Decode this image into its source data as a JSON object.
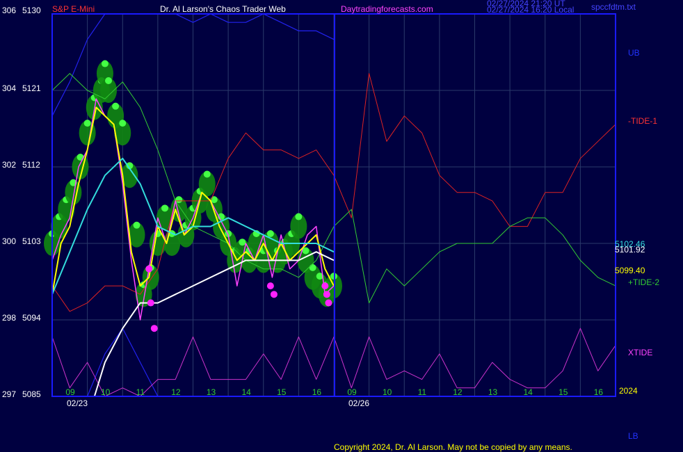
{
  "header": {
    "instrument": "S&P E-Mini",
    "author": "Dr. Al Larson's Chaos Trader Web",
    "site": "Daytradingforecasts.com",
    "time_line1": "02/27/2024 21:20 UT",
    "time_line2": "02/27/2024 16:20 Local",
    "file": "spccfdtm.txt"
  },
  "footer": {
    "copyright": "Copyright 2024, Dr. Al Larson. May not be copied by any means."
  },
  "colors": {
    "background": "#000040",
    "frame": "#1a1aff",
    "grid": "#2a3a6a",
    "price": "#ff44ff",
    "yellow_avg": "#ffff00",
    "cyan_avg": "#33dddd",
    "white_avg": "#ffffff",
    "tide1": "#dd2222",
    "tide2": "#33cc33",
    "xtide": "#cc33cc",
    "bands": "#2222ee",
    "marker_green": "#22cc22",
    "marker_magenta": "#ff22ff"
  },
  "chart_data": {
    "type": "line",
    "title": "S&P E-Mini",
    "y_axis_left_outer": {
      "ticks": [
        "306",
        "304",
        "302",
        "300",
        "298",
        "297"
      ]
    },
    "y_axis_left_inner": {
      "ticks": [
        "5130",
        "5121",
        "5112",
        "5103",
        "5094",
        "5085"
      ],
      "range": [
        5085,
        5130
      ]
    },
    "x_axis": {
      "hour_ticks": [
        "09",
        "10",
        "11",
        "12",
        "13",
        "14",
        "15",
        "16",
        "09",
        "10",
        "11",
        "12",
        "13",
        "14",
        "15",
        "16"
      ],
      "dates": [
        "02/23",
        "02/26"
      ],
      "year": "2024"
    },
    "right_labels": {
      "ub": "UB",
      "tide1": "-TIDE-1",
      "v1": "5102.46",
      "v2": "5101.92",
      "v3": "5099.40",
      "tide2": "+TIDE-2",
      "xtide": "XTIDE",
      "lb": "LB"
    },
    "series": [
      {
        "name": "-TIDE-1",
        "color": "tide1",
        "x": [
          0,
          0.5,
          1,
          1.5,
          2,
          2.5,
          3,
          3.5,
          4,
          4.5,
          5,
          5.5,
          6,
          6.5,
          7,
          7.5,
          8,
          8.5,
          9,
          9.5,
          10,
          10.5,
          11,
          11.5,
          12,
          12.5,
          13,
          13.5,
          14,
          14.5,
          15,
          15.5,
          16
        ],
        "y": [
          5098,
          5095,
          5096,
          5098,
          5098,
          5097,
          5100,
          5108,
          5108,
          5108,
          5113,
          5116,
          5114,
          5114,
          5113,
          5114,
          5111,
          5106,
          5123,
          5115,
          5118,
          5116,
          5111,
          5109,
          5109,
          5108,
          5105,
          5105,
          5109,
          5109,
          5113,
          5115,
          5117
        ]
      },
      {
        "name": "+TIDE-2",
        "color": "tide2",
        "x": [
          0,
          0.5,
          1,
          1.5,
          2,
          2.5,
          3,
          3.5,
          4,
          4.5,
          5,
          5.5,
          6,
          6.5,
          7,
          7.5,
          8,
          8.5,
          9,
          9.5,
          10,
          10.5,
          11,
          11.5,
          12,
          12.5,
          13,
          13.5,
          14,
          14.5,
          15,
          15.5,
          16
        ],
        "y": [
          5121,
          5123,
          5121,
          5120,
          5122,
          5119,
          5114,
          5108,
          5105,
          5104,
          5103,
          5101,
          5100,
          5100,
          5099,
          5101,
          5105,
          5107,
          5096,
          5100,
          5098,
          5100,
          5102,
          5103,
          5103,
          5103,
          5105,
          5106,
          5106,
          5104,
          5101,
          5099,
          5098
        ]
      },
      {
        "name": "XTIDE",
        "color": "xtide",
        "x": [
          0,
          0.5,
          1,
          1.5,
          2,
          2.5,
          3,
          3.5,
          4,
          4.5,
          5,
          5.5,
          6,
          6.5,
          7,
          7.5,
          8,
          8.5,
          9,
          9.5,
          10,
          10.5,
          11,
          11.5,
          12,
          12.5,
          13,
          13.5,
          14,
          14.5,
          15,
          15.5,
          16
        ],
        "y": [
          5092,
          5086,
          5089,
          5085,
          5086,
          5085,
          5087,
          5087,
          5092,
          5087,
          5087,
          5087,
          5090,
          5087,
          5092,
          5087,
          5092,
          5086,
          5092,
          5087,
          5088,
          5087,
          5090,
          5086,
          5086,
          5089,
          5087,
          5086,
          5086,
          5088,
          5093,
          5088,
          5091
        ]
      },
      {
        "name": "UB",
        "color": "bands",
        "x": [
          0,
          0.5,
          1,
          1.5,
          2,
          2.5,
          3,
          3.5,
          4,
          4.5,
          5,
          5.5,
          6,
          6.5,
          7,
          7.5,
          8
        ],
        "y": [
          5118,
          5122,
          5127,
          5131,
          5133,
          5134,
          5132,
          5130,
          5129,
          5130,
          5129,
          5129,
          5130,
          5129,
          5128,
          5128,
          5127
        ]
      },
      {
        "name": "LB",
        "color": "bands",
        "x": [
          0,
          0.5,
          1,
          1.5,
          2,
          2.5,
          3,
          3.5,
          4
        ],
        "y": [
          5072,
          5078,
          5084,
          5090,
          5093,
          5089,
          5080,
          5072,
          5066
        ]
      },
      {
        "name": "Price",
        "color": "price",
        "x": [
          0,
          0.25,
          0.5,
          0.75,
          1,
          1.25,
          1.5,
          1.75,
          2,
          2.25,
          2.5,
          2.75,
          3,
          3.25,
          3.5,
          3.75,
          4,
          4.25,
          4.5,
          4.75,
          5,
          5.25,
          5.5,
          5.75,
          6,
          6.25,
          6.5,
          6.75,
          7,
          7.25,
          7.5,
          7.75,
          8
        ],
        "y": [
          5101,
          5104,
          5106,
          5112,
          5114,
          5120,
          5118,
          5117,
          5110,
          5101,
          5094,
          5100,
          5106,
          5103,
          5108,
          5104,
          5106,
          5109,
          5108,
          5106,
          5104,
          5098,
          5103,
          5101,
          5104,
          5099,
          5104,
          5100,
          5101,
          5104,
          5105,
          5097,
          5098
        ]
      },
      {
        "name": "Yellow",
        "color": "yellow_avg",
        "x": [
          0,
          0.25,
          0.5,
          0.75,
          1,
          1.25,
          1.5,
          1.75,
          2,
          2.25,
          2.5,
          2.75,
          3,
          3.25,
          3.5,
          3.75,
          4,
          4.25,
          4.5,
          4.75,
          5,
          5.25,
          5.5,
          5.75,
          6,
          6.25,
          6.5,
          6.75,
          7,
          7.25,
          7.5,
          7.75,
          8
        ],
        "y": [
          5097,
          5103,
          5105,
          5110,
          5114,
          5119,
          5118,
          5117,
          5111,
          5102,
          5098,
          5099,
          5105,
          5103,
          5107,
          5104,
          5105,
          5109,
          5108,
          5105,
          5103,
          5101,
          5102,
          5101,
          5103,
          5101,
          5103,
          5101,
          5102,
          5103,
          5104,
          5100,
          5098
        ]
      },
      {
        "name": "Cyan",
        "color": "cyan_avg",
        "x": [
          0,
          0.5,
          1,
          1.5,
          2,
          2.5,
          3,
          3.5,
          4,
          4.5,
          5,
          5.5,
          6,
          6.5,
          7,
          7.5,
          8
        ],
        "y": [
          5097,
          5102,
          5107,
          5111,
          5113,
          5110,
          5105,
          5104,
          5105,
          5105,
          5106,
          5105,
          5104,
          5103,
          5103,
          5103,
          5102
        ]
      },
      {
        "name": "White",
        "color": "white_avg",
        "x": [
          1.2,
          1.5,
          2,
          2.5,
          3,
          3.5,
          4,
          4.5,
          5,
          5.5,
          6,
          6.5,
          7,
          7.5,
          8
        ],
        "y": [
          5085,
          5089,
          5093,
          5096,
          5096,
          5097,
          5098,
          5099,
          5100,
          5101,
          5101,
          5101,
          5101,
          5102,
          5101
        ]
      }
    ],
    "markers": {
      "green_x": [
        0,
        0.2,
        0.4,
        0.6,
        0.8,
        1.0,
        1.2,
        1.4,
        1.5,
        1.6,
        1.8,
        2.0,
        2.2,
        2.4,
        2.6,
        2.8,
        3.0,
        3.2,
        3.4,
        3.6,
        3.8,
        4.0,
        4.2,
        4.4,
        4.6,
        4.8,
        5.0,
        5.2,
        5.4,
        5.6,
        5.8,
        6.0,
        6.2,
        6.4,
        6.6,
        6.8,
        7.0,
        7.2,
        7.4,
        7.6,
        7.8,
        8.0
      ],
      "green_y": [
        5103,
        5105,
        5107,
        5109,
        5112,
        5116,
        5119,
        5121,
        5123,
        5121,
        5118,
        5116,
        5111,
        5104,
        5097,
        5099,
        5103,
        5106,
        5103,
        5107,
        5104,
        5106,
        5108,
        5110,
        5107,
        5105,
        5103,
        5101,
        5102,
        5101,
        5103,
        5101,
        5103,
        5101,
        5102,
        5103,
        5105,
        5101,
        5099,
        5098,
        5097,
        5098
      ],
      "magenta_x": [
        2.75,
        2.8,
        2.9,
        6.2,
        6.3,
        7.75,
        7.8,
        7.85
      ],
      "magenta_y": [
        5100,
        5096,
        5093,
        5098,
        5097,
        5098,
        5097,
        5096
      ]
    }
  }
}
